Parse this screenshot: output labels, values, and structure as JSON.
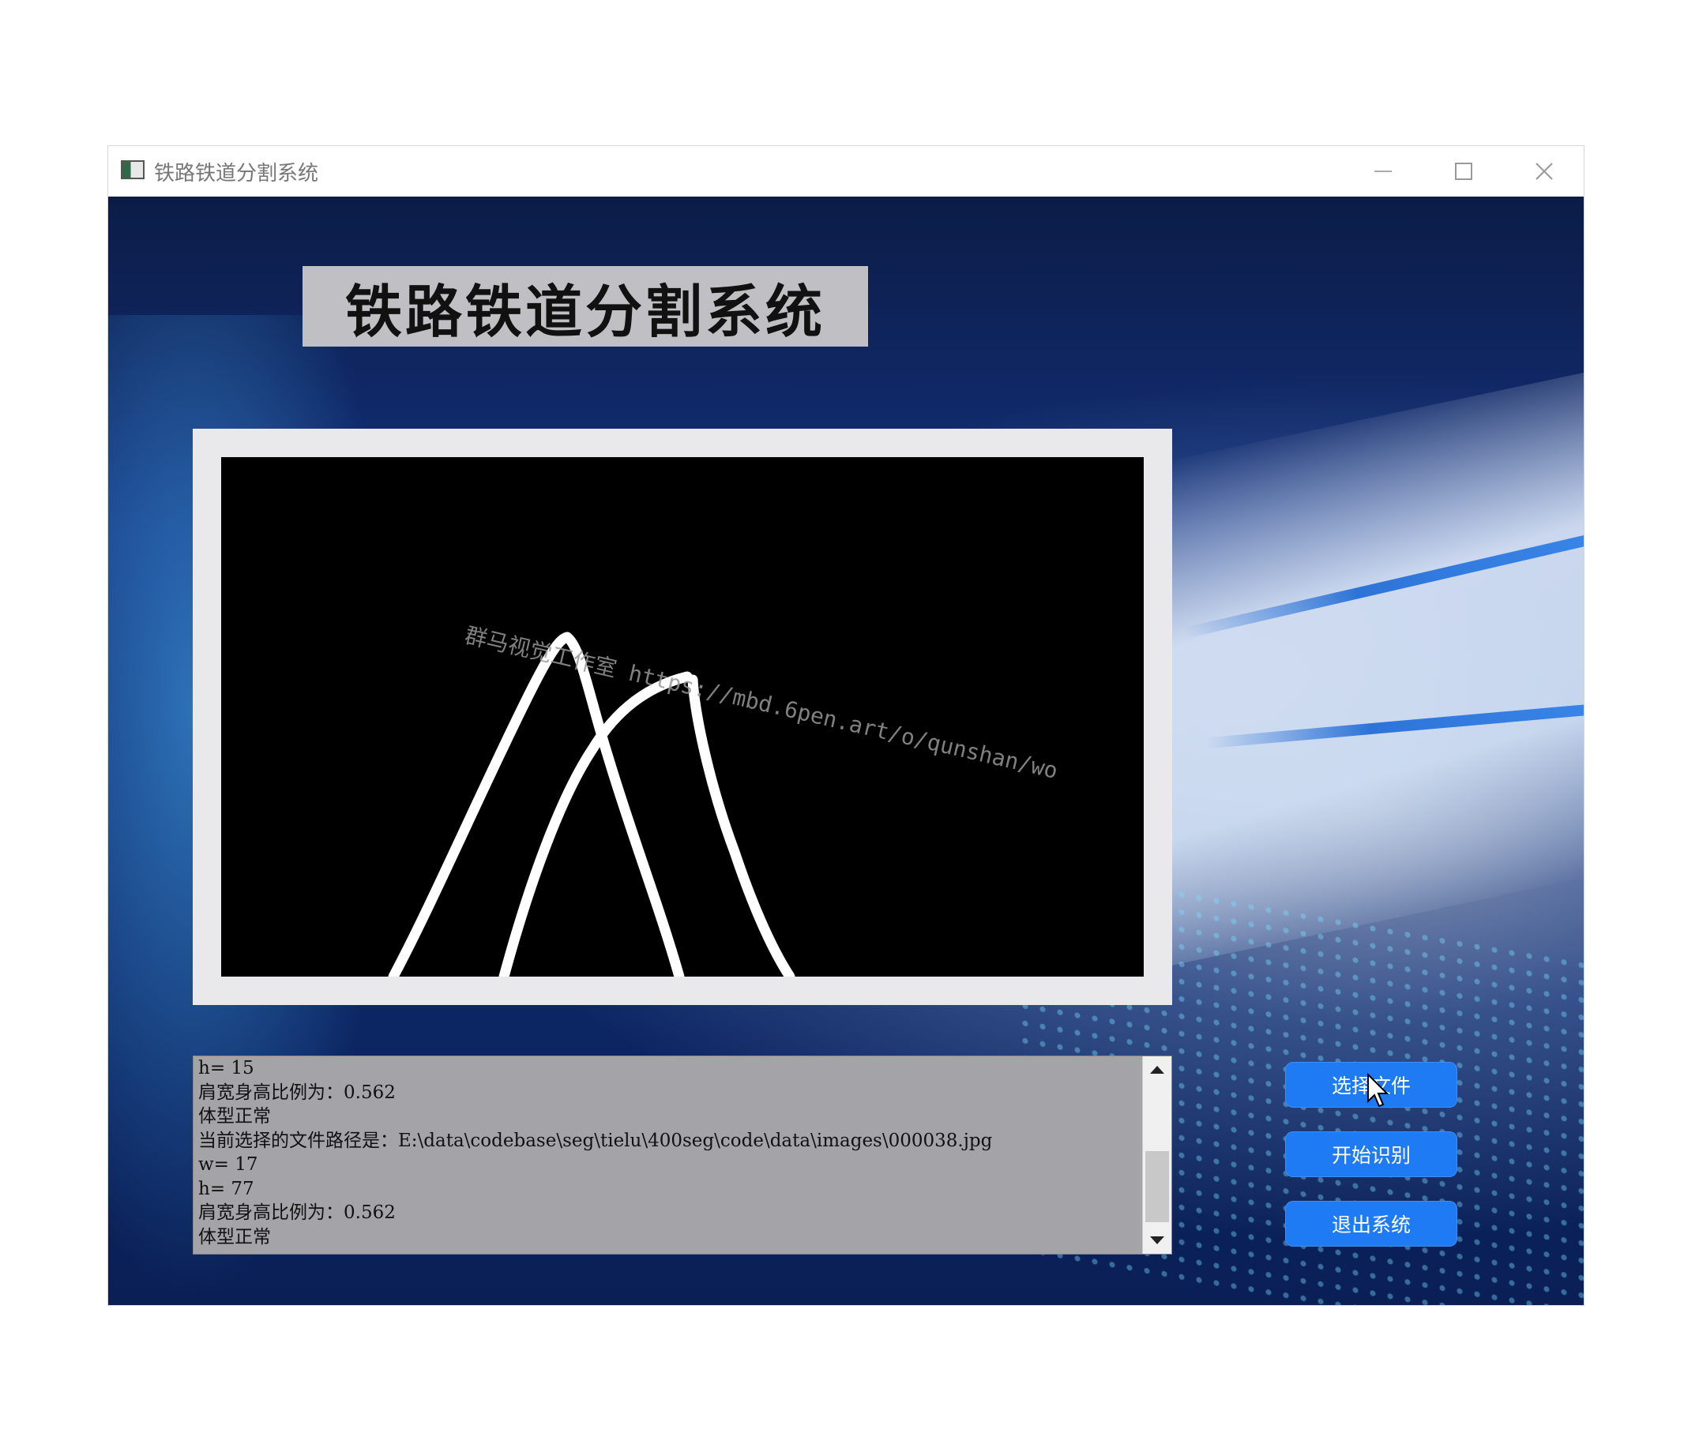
{
  "window": {
    "title": "铁路铁道分割系统"
  },
  "header": {
    "title": "铁路铁道分割系统"
  },
  "image_panel": {
    "watermark": "群马视觉工作室 https://mbd.6pen.art/o/qunshan/wo"
  },
  "log": {
    "lines": [
      "h= 15",
      "肩宽身高比例为：0.562",
      "体型正常",
      "当前选择的文件路径是：E:\\data\\codebase\\seg\\tielu\\400seg\\code\\data\\images\\000038.jpg",
      "w= 17",
      "h= 77",
      "肩宽身高比例为：0.562",
      "体型正常"
    ]
  },
  "buttons": {
    "select_file": "选择文件",
    "start_recognition": "开始识别",
    "exit_system": "退出系统"
  },
  "colors": {
    "button_blue": "#1e7bf3",
    "log_bg": "#a4a4a8",
    "title_box_bg": "#bfbfc4"
  }
}
